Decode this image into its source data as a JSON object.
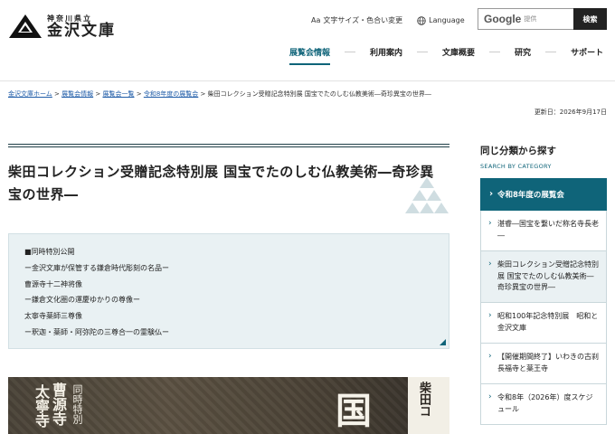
{
  "logo": {
    "sub": "神奈川県立",
    "main": "金沢文庫"
  },
  "utility": {
    "text_size": "文字サイズ・色合い変更",
    "text_size_icon": "text-size-icon",
    "language": "Language",
    "language_icon": "globe-icon"
  },
  "search": {
    "brand": "Google",
    "brand_sub": "提供",
    "button": "検索"
  },
  "nav": [
    {
      "label": "展覧会情報",
      "active": true
    },
    {
      "label": "利用案内"
    },
    {
      "label": "文庫概要"
    },
    {
      "label": "研究"
    },
    {
      "label": "サポート"
    }
  ],
  "breadcrumb": {
    "items": [
      "金沢文庫ホーム",
      "展覧会情報",
      "展覧会一覧",
      "令和8年度の展覧会"
    ],
    "separator": ">",
    "current": "柴田コレクション受贈記念特別展 国宝でたのしむ仏教美術―奇珍異宝の世界―"
  },
  "updated": "更新日：2026年9月17日",
  "page_title": "柴田コレクション受贈記念特別展 国宝でたのしむ仏教美術―奇珍異宝の世界―",
  "info_lines": [
    "■同時特別公開",
    "ー金沢文庫が保管する鎌倉時代彫刻の名品ー",
    "曹源寺十二神将像",
    "ー鎌倉文化圏の運慶ゆかりの尊像ー",
    "太寧寺薬師三尊像",
    "ー釈迦・薬師・阿弥陀の三尊合一の霊験仏ー"
  ],
  "hero": {
    "v1": "太寧寺",
    "v2": "曹源寺",
    "v3": "同時特別",
    "big": "国",
    "right": "柴田コ"
  },
  "sidebar": {
    "title": "同じ分類から探す",
    "subtitle": "SEARCH BY CATEGORY",
    "head": "令和8年度の展覧会",
    "items": [
      "湛睿―国宝を繋いだ称名寺長老―",
      "柴田コレクション受贈記念特別展 国宝でたのしむ仏教美術―奇珍異宝の世界―",
      "昭和100年記念特別展　昭和と金沢文庫",
      "【開催期間終了】いわきの古刹 長福寺と薬王寺",
      "令和8年（2026年）度スケジュール"
    ]
  },
  "colors": {
    "accent": "#0f6479",
    "info_bg": "#e9f1f3"
  }
}
